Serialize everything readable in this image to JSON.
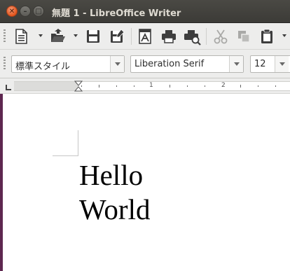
{
  "window": {
    "title": "無題 1 - LibreOffice Writer",
    "close_glyph": "✕",
    "minimize_glyph": "–",
    "maximize_glyph": "□"
  },
  "toolbar": {
    "icons": [
      "new-document-icon",
      "open-folder-icon",
      "save-icon",
      "save-as-icon",
      "export-pdf-icon",
      "print-icon",
      "print-preview-icon",
      "cut-icon",
      "copy-icon",
      "paste-icon"
    ]
  },
  "formatting": {
    "paragraph_style": "標準スタイル",
    "font_name": "Liberation Serif",
    "font_size": "12"
  },
  "ruler": {
    "labels": [
      "1",
      "2"
    ]
  },
  "document": {
    "lines": [
      "Hello",
      "World"
    ]
  },
  "colors": {
    "titlebar": "#3c3b37",
    "close_button": "#e2551c",
    "toolbar_bg": "#ededec",
    "window_edge": "#5e2750"
  }
}
